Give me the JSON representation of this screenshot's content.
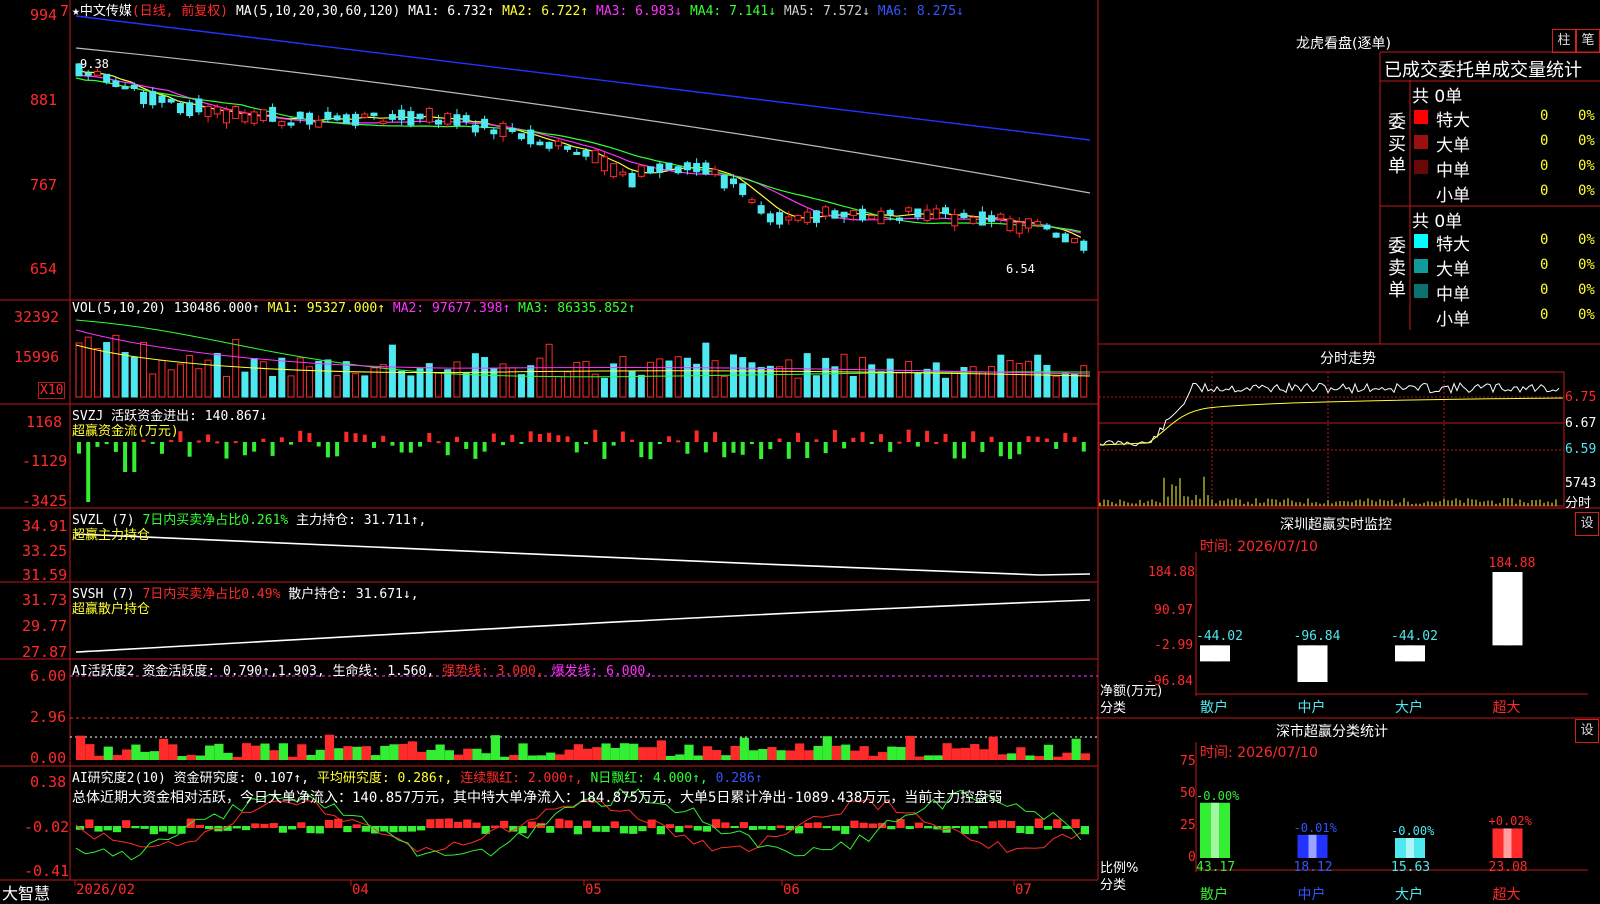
{
  "main": {
    "marker_left": "7",
    "title": "★中文传媒",
    "mode": "(日线, 前复权)",
    "ma_label": "MA(5,10,20,30,60,120)",
    "ma1": "MA1: 6.732↑",
    "ma2": "MA2: 6.722↑",
    "ma3": "MA3: 6.983↓",
    "ma4": "MA4: 7.141↓",
    "ma5": "MA5: 7.572↓",
    "ma6": "MA6: 8.275↓",
    "yticks": [
      "994",
      "881",
      "767",
      "654"
    ],
    "hi_label": "9.38",
    "lo_label": "6.54"
  },
  "vol": {
    "label": "VOL(5,10,20)",
    "value": "130486.000↑",
    "ma1": "MA1: 95327.000↑",
    "ma2": "MA2: 97677.398↑",
    "ma3": "MA3: 86335.852↑",
    "yticks": [
      "32392",
      "15996"
    ],
    "unit": "X10"
  },
  "svzj": {
    "label": "SVZJ",
    "active": "活跃资金进出: 140.867↓",
    "sub": "超赢资金流(万元)",
    "yticks": [
      "1168",
      "-1129",
      "-3425"
    ]
  },
  "svzl": {
    "label": "SVZL (7)",
    "ratio": "7日内买卖净占比0.261%",
    "hold": "主力持仓: 31.711↑,",
    "sub": "超赢主力持仓",
    "yticks": [
      "34.91",
      "33.25",
      "31.59"
    ]
  },
  "svsh": {
    "label": "SVSH (7)",
    "ratio": "7日内买卖净占比0.49%",
    "hold": "散户持仓: 31.671↓,",
    "sub": "超赢散户持仓",
    "yticks": [
      "31.73",
      "29.77",
      "27.87"
    ]
  },
  "ai1": {
    "label": "AI活跃度2",
    "act": "资金活跃度: 0.790↑,1.903,",
    "life": "生命线: 1.560,",
    "strong": "强势线: 3.000,",
    "burst": "爆发线: 6.000,",
    "yticks": [
      "6.00",
      "2.96",
      "0.00"
    ]
  },
  "ai2": {
    "label": "AI研究度2(10)",
    "research": "资金研究度: 0.107↑,",
    "avg": "平均研究度: 0.286↑,",
    "streak": "连续飘红: 2.000↑,",
    "nday": "N日飘红: 4.000↑,",
    "last": "0.286↑",
    "summary": "总体近期大资金相对活跃，今日大单净流入：140.857万元，其中特大单净流入：184.875万元，大单5日累计净出-1089.438万元，当前主力控盘弱",
    "yticks": [
      "0.38",
      "-0.02",
      "-0.41"
    ]
  },
  "timeline": {
    "brand": "大智慧",
    "ticks": [
      "2026/02",
      "04",
      "05",
      "06",
      "07"
    ]
  },
  "longhu": {
    "title": "龙虎看盘(逐单)",
    "btn_bar": "柱",
    "btn_pen": "笔",
    "header": "已成交委托单成交量统计",
    "buy_side": "委买单",
    "sell_side": "委卖单",
    "buy_total": "共 0单",
    "sell_total": "共 0单",
    "buy_rows": [
      {
        "name": "特大",
        "count": "0",
        "pct": "0%",
        "color": "#ff0000"
      },
      {
        "name": "大单",
        "count": "0",
        "pct": "0%",
        "color": "#9a1010"
      },
      {
        "name": "中单",
        "count": "0",
        "pct": "0%",
        "color": "#6a0808"
      },
      {
        "name": "小单",
        "count": "0",
        "pct": "0%",
        "color": ""
      }
    ],
    "sell_rows": [
      {
        "name": "特大",
        "count": "0",
        "pct": "0%",
        "color": "#00ffff"
      },
      {
        "name": "大单",
        "count": "0",
        "pct": "0%",
        "color": "#109a9a"
      },
      {
        "name": "中单",
        "count": "0",
        "pct": "0%",
        "color": "#0a7070"
      },
      {
        "name": "小单",
        "count": "0",
        "pct": "0%",
        "color": ""
      }
    ]
  },
  "intraday": {
    "title": "分时走势",
    "yticks": [
      "6.75",
      "6.67",
      "6.59"
    ],
    "vol_label": "5743",
    "unit": "分时"
  },
  "monitor": {
    "title": "深圳超赢实时监控",
    "btn": "设",
    "time": "时间: 2026/07/10",
    "ylabel": "净额(万元)",
    "xlabel": "分类",
    "yticks": [
      "184.88",
      "90.97",
      "-2.99",
      "-96.84"
    ],
    "chart_data": {
      "type": "bar",
      "categories": [
        "散户",
        "中户",
        "大户",
        "超大"
      ],
      "values": [
        -44.02,
        -96.84,
        -44.02,
        184.88
      ],
      "value_labels": [
        "-44.02",
        "-96.84",
        "-44.02",
        "184.88"
      ],
      "ylim": [
        -96.84,
        184.88
      ],
      "ylabel": "净额(万元)",
      "xlabel": "分类"
    }
  },
  "classify": {
    "title": "深市超赢分类统计",
    "btn": "设",
    "time": "时间: 2026/07/10",
    "ylabel": "比例%",
    "xlabel": "分类",
    "yticks": [
      "75",
      "50",
      "25",
      "0"
    ],
    "chart_data": {
      "type": "bar",
      "categories": [
        "散户",
        "中户",
        "大户",
        "超大"
      ],
      "values": [
        43.17,
        18.12,
        15.63,
        23.08
      ],
      "value_labels": [
        "43.17",
        "18.12",
        "15.63",
        "23.08"
      ],
      "change_labels": [
        "-0.00%",
        "-0.01%",
        "-0.00%",
        "+0.02%"
      ],
      "ylim": [
        0,
        75
      ],
      "ylabel": "比例%",
      "xlabel": "分类"
    }
  }
}
